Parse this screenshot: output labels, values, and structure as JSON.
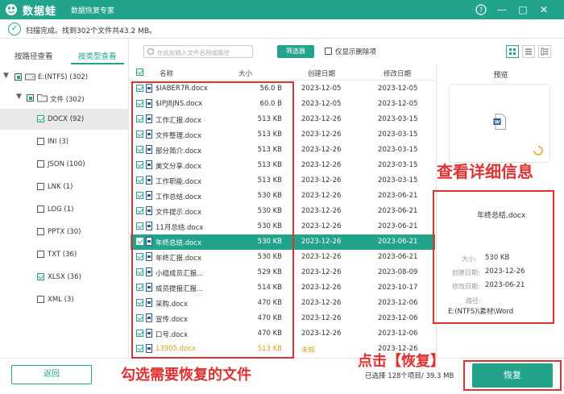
{
  "app": {
    "brand": "数据蛙",
    "subtitle": "数据恢复专家"
  },
  "status": {
    "text": "扫描完成。找到302个文件共43.2 MB。"
  },
  "left_tabs": [
    {
      "label": "按路径查看",
      "active": false
    },
    {
      "label": "按类型查看",
      "active": true
    }
  ],
  "tree": {
    "drive": "E:(NTFS) (302)",
    "folder": "文件 (302)",
    "types": [
      {
        "label": "DOCX (92)",
        "checked": true,
        "selected": true
      },
      {
        "label": "INI (3)",
        "checked": false
      },
      {
        "label": "JSON (100)",
        "checked": false
      },
      {
        "label": "LNK (1)",
        "checked": false
      },
      {
        "label": "LOG (1)",
        "checked": false
      },
      {
        "label": "PPTX (30)",
        "checked": false
      },
      {
        "label": "TXT (36)",
        "checked": false
      },
      {
        "label": "XLSX (36)",
        "checked": true
      },
      {
        "label": "XML (3)",
        "checked": false
      }
    ]
  },
  "toolbar": {
    "search_placeholder": "在此处输入文件名称或路径",
    "filter_label": "筛选器",
    "deleted_only_label": "仅显示删除项"
  },
  "columns": {
    "name": "名称",
    "size": "大小",
    "created": "创建日期",
    "modified": "修改日期"
  },
  "files": [
    {
      "name": "$IABER7R.docx",
      "size": "56.0 B",
      "created": "2023-12-05",
      "modified": "2023-12-05"
    },
    {
      "name": "$IPJ8JNS.docx",
      "size": "60.0 B",
      "created": "2023-12-05",
      "modified": "2023-12-05"
    },
    {
      "name": "工作汇报.docx",
      "size": "513 KB",
      "created": "2023-12-26",
      "modified": "2023-03-15"
    },
    {
      "name": "文件整理.docx",
      "size": "513 KB",
      "created": "2023-12-26",
      "modified": "2023-03-15"
    },
    {
      "name": "部分简介.docx",
      "size": "513 KB",
      "created": "2023-12-26",
      "modified": "2023-03-15"
    },
    {
      "name": "美文分享.docx",
      "size": "513 KB",
      "created": "2023-12-26",
      "modified": "2023-03-15"
    },
    {
      "name": "工作职能.docx",
      "size": "513 KB",
      "created": "2023-12-26",
      "modified": "2023-03-15"
    },
    {
      "name": "工作总结.docx",
      "size": "530 KB",
      "created": "2023-12-26",
      "modified": "2023-06-21"
    },
    {
      "name": "文件提示.docx",
      "size": "530 KB",
      "created": "2023-12-26",
      "modified": "2023-06-21"
    },
    {
      "name": "11月总结.docx",
      "size": "530 KB",
      "created": "2023-12-26",
      "modified": "2023-06-21"
    },
    {
      "name": "年终总结.docx",
      "size": "530 KB",
      "created": "2023-12-26",
      "modified": "2023-06-21"
    },
    {
      "name": "年终汇报.docx",
      "size": "530 KB",
      "created": "2023-12-26",
      "modified": "2023-06-21"
    },
    {
      "name": "小组成员汇报...",
      "size": "529 KB",
      "created": "2023-12-26",
      "modified": "2023-08-09"
    },
    {
      "name": "成员提报汇报...",
      "size": "514 KB",
      "created": "2023-12-26",
      "modified": "2023-10-17"
    },
    {
      "name": "采购.docx",
      "size": "470 KB",
      "created": "2023-12-26",
      "modified": "2023-12-06"
    },
    {
      "name": "宣传.docx",
      "size": "470 KB",
      "created": "2023-12-26",
      "modified": "2023-12-06"
    },
    {
      "name": "口号.docx",
      "size": "470 KB",
      "created": "2023-12-26",
      "modified": "2023-12-06"
    },
    {
      "name": "13905.docx",
      "size": "513 KB",
      "created": "未知",
      "modified": "2023-12-26"
    }
  ],
  "preview": {
    "title": "预览",
    "file_name": "年终总结.docx",
    "size_label": "大小:",
    "size_value": "530 KB",
    "created_label": "创建日期:",
    "created_value": "2023-12-26",
    "modified_label": "修改日期:",
    "modified_value": "2023-06-21",
    "path_label": "路径:",
    "path_value": "E:(NTFS)\\素材\\Word"
  },
  "footer": {
    "back_label": "返回",
    "selection_info": "已选择 128个项目/ 39.3 MB",
    "recover_label": "恢复"
  },
  "annotations": {
    "details": "查看详细信息",
    "select": "勾选需要恢复的文件",
    "click": "点击【恢复】"
  },
  "colors": {
    "accent": "#22a38c",
    "annotation": "#e03030",
    "unknown_row": "#e0a020"
  }
}
